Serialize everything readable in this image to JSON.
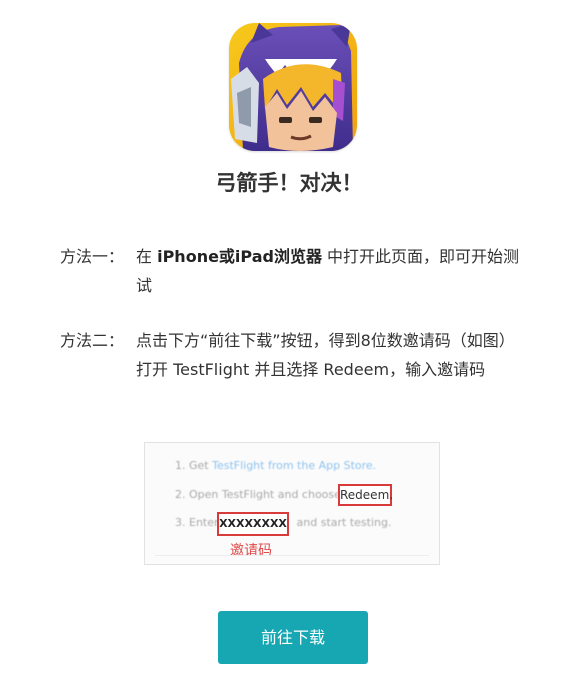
{
  "app": {
    "title": "弓箭手！对决！",
    "icon_name": "archer-character-app-icon"
  },
  "instructions": {
    "method_1": {
      "label": "方法一：",
      "prefix": "在 ",
      "highlight": "iPhone或iPad浏览器",
      "suffix": " 中打开此页面，即可开始测试"
    },
    "method_2": {
      "label": "方法二：",
      "text": "点击下方“前往下载”按钮，得到8位数邀请码（如图）打开 TestFlight 并且选择 Redeem，输入邀请码"
    }
  },
  "example": {
    "step_1_prefix": "1. Get ",
    "step_1_link": "TestFlight from the App Store.",
    "step_2_prefix": "2. Open TestFlight and choose",
    "redeem_label": "Redeem.",
    "step_3_prefix": "3. Enter",
    "code_placeholder": "XXXXXXXX",
    "step_3_suffix": "and start testing.",
    "code_caption": "邀请码"
  },
  "download_button": {
    "label": "前往下载"
  },
  "colors": {
    "button": "#16a7b3",
    "highlight_red": "#d93a3a",
    "text": "#333333"
  }
}
